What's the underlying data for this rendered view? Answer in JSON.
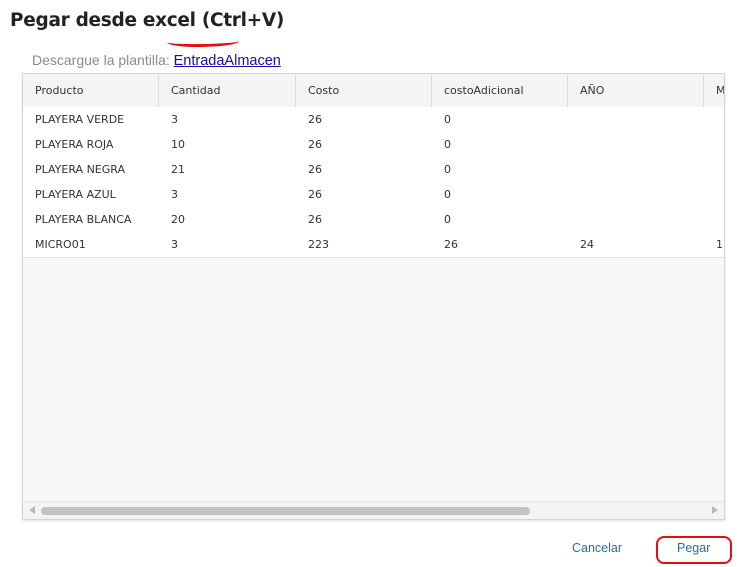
{
  "dialog": {
    "title": "Pegar desde excel",
    "shortcut": "(Ctrl+V)",
    "template_prefix": "Descargue la plantilla:",
    "template_link": "EntradaAlmacen"
  },
  "grid": {
    "columns": [
      "Producto",
      "Cantidad",
      "Costo",
      "costoAdicional",
      "AÑO",
      "M"
    ],
    "rows": [
      [
        "PLAYERA VERDE",
        "3",
        "26",
        "0",
        "",
        ""
      ],
      [
        "PLAYERA ROJA",
        "10",
        "26",
        "0",
        "",
        ""
      ],
      [
        "PLAYERA NEGRA",
        "21",
        "26",
        "0",
        "",
        ""
      ],
      [
        "PLAYERA AZUL",
        "3",
        "26",
        "0",
        "",
        ""
      ],
      [
        "PLAYERA BLANCA",
        "20",
        "26",
        "0",
        "",
        ""
      ],
      [
        "MICRO01",
        "3",
        "223",
        "26",
        "24",
        "1"
      ]
    ]
  },
  "footer": {
    "cancel_label": "Cancelar",
    "paste_label": "Pegar"
  },
  "colors": {
    "annotation": "#e01010",
    "link": "#1a0dab",
    "button_text": "#2a6ca8"
  }
}
